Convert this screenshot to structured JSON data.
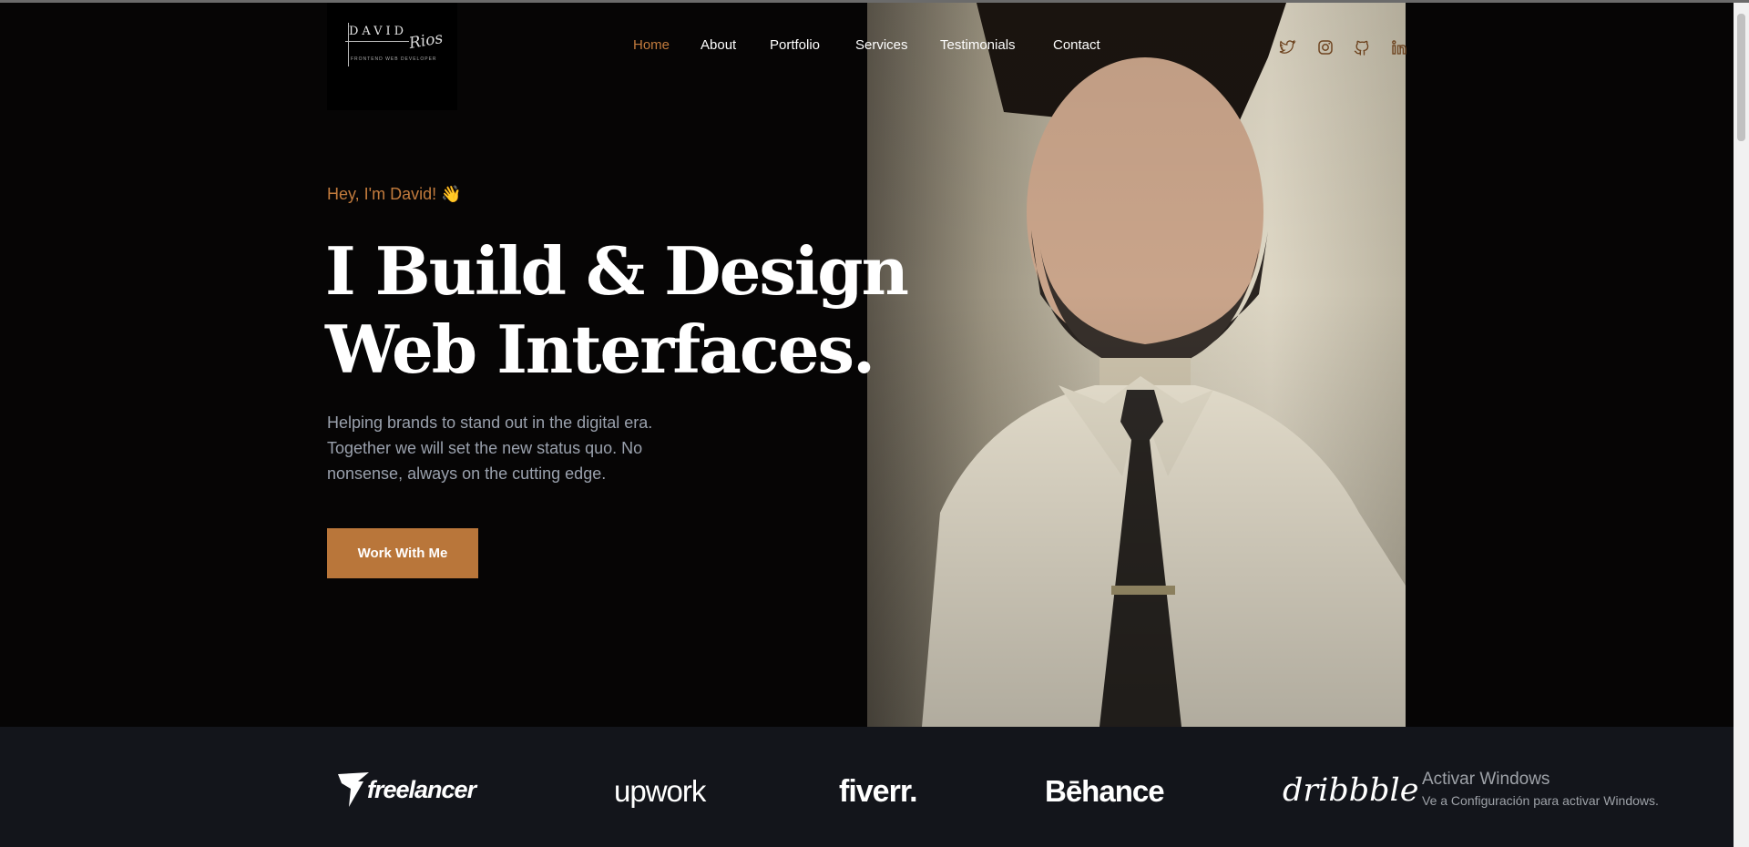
{
  "logo": {
    "name": "DAVID",
    "signature": "Rios",
    "subtitle": "FRONTEND WEB DEVELOPER"
  },
  "nav": {
    "items": [
      {
        "label": "Home",
        "active": true
      },
      {
        "label": "About",
        "active": false
      },
      {
        "label": "Portfolio",
        "active": false
      },
      {
        "label": "Services",
        "active": false
      },
      {
        "label": "Testimonials",
        "active": false
      },
      {
        "label": "Contact",
        "active": false
      }
    ]
  },
  "social": [
    "twitter-icon",
    "instagram-icon",
    "github-icon",
    "linkedin-icon"
  ],
  "hero": {
    "greeting": "Hey, I'm David! 👋",
    "headline_line1": "I Build & Design",
    "headline_line2": "Web Interfaces.",
    "description": "Helping brands to stand out in the digital era. Together we will set the new status quo. No nonsense, always on the cutting edge.",
    "cta_label": "Work With Me"
  },
  "brands": {
    "freelancer": "freelancer",
    "upwork": "upwork",
    "fiverr": "fiverr.",
    "behance": "Bēhance",
    "dribbble": "dribbble"
  },
  "watermark": {
    "title": "Activar Windows",
    "subtitle": "Ve a Configuración para activar Windows."
  },
  "colors": {
    "accent": "#c27b3d",
    "button": "#b9763a",
    "background": "#060505",
    "logo_bar": "#13151b"
  }
}
